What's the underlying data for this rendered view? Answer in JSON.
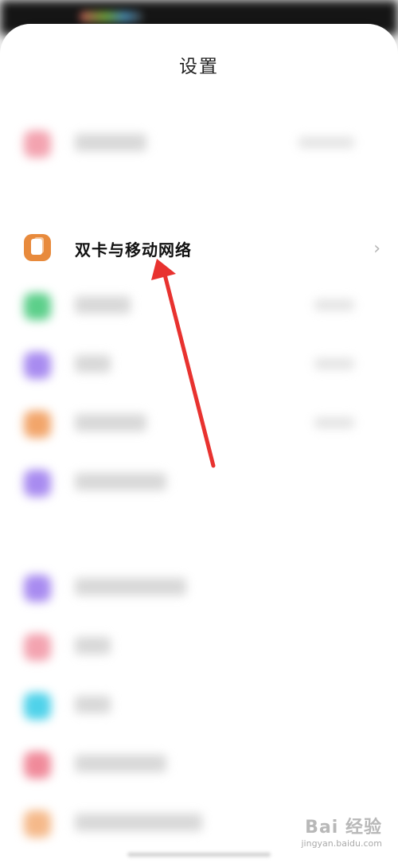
{
  "header": {
    "title": "设置"
  },
  "focus_item": {
    "label": "双卡与移动网络",
    "icon": "sim-card-icon",
    "chevron": "›",
    "icon_color": "#e88a3c"
  },
  "blurred_items": [
    {
      "icon_color": "#f3a3b0"
    },
    {
      "icon_color": "#5ccf8a"
    },
    {
      "icon_color": "#a88bf0"
    },
    {
      "icon_color": "#f2a56a"
    },
    {
      "icon_color": "#a88bf0"
    },
    {
      "icon_color": "#a88bf0"
    },
    {
      "icon_color": "#f3a3b0"
    },
    {
      "icon_color": "#4fd2ea"
    },
    {
      "icon_color": "#f08a9a"
    },
    {
      "icon_color": "#f5b98a"
    }
  ],
  "annotation": {
    "arrow_color": "#e8322f"
  },
  "watermark": {
    "logo": "Bai 经验",
    "site": "jingyan.baidu.com"
  }
}
